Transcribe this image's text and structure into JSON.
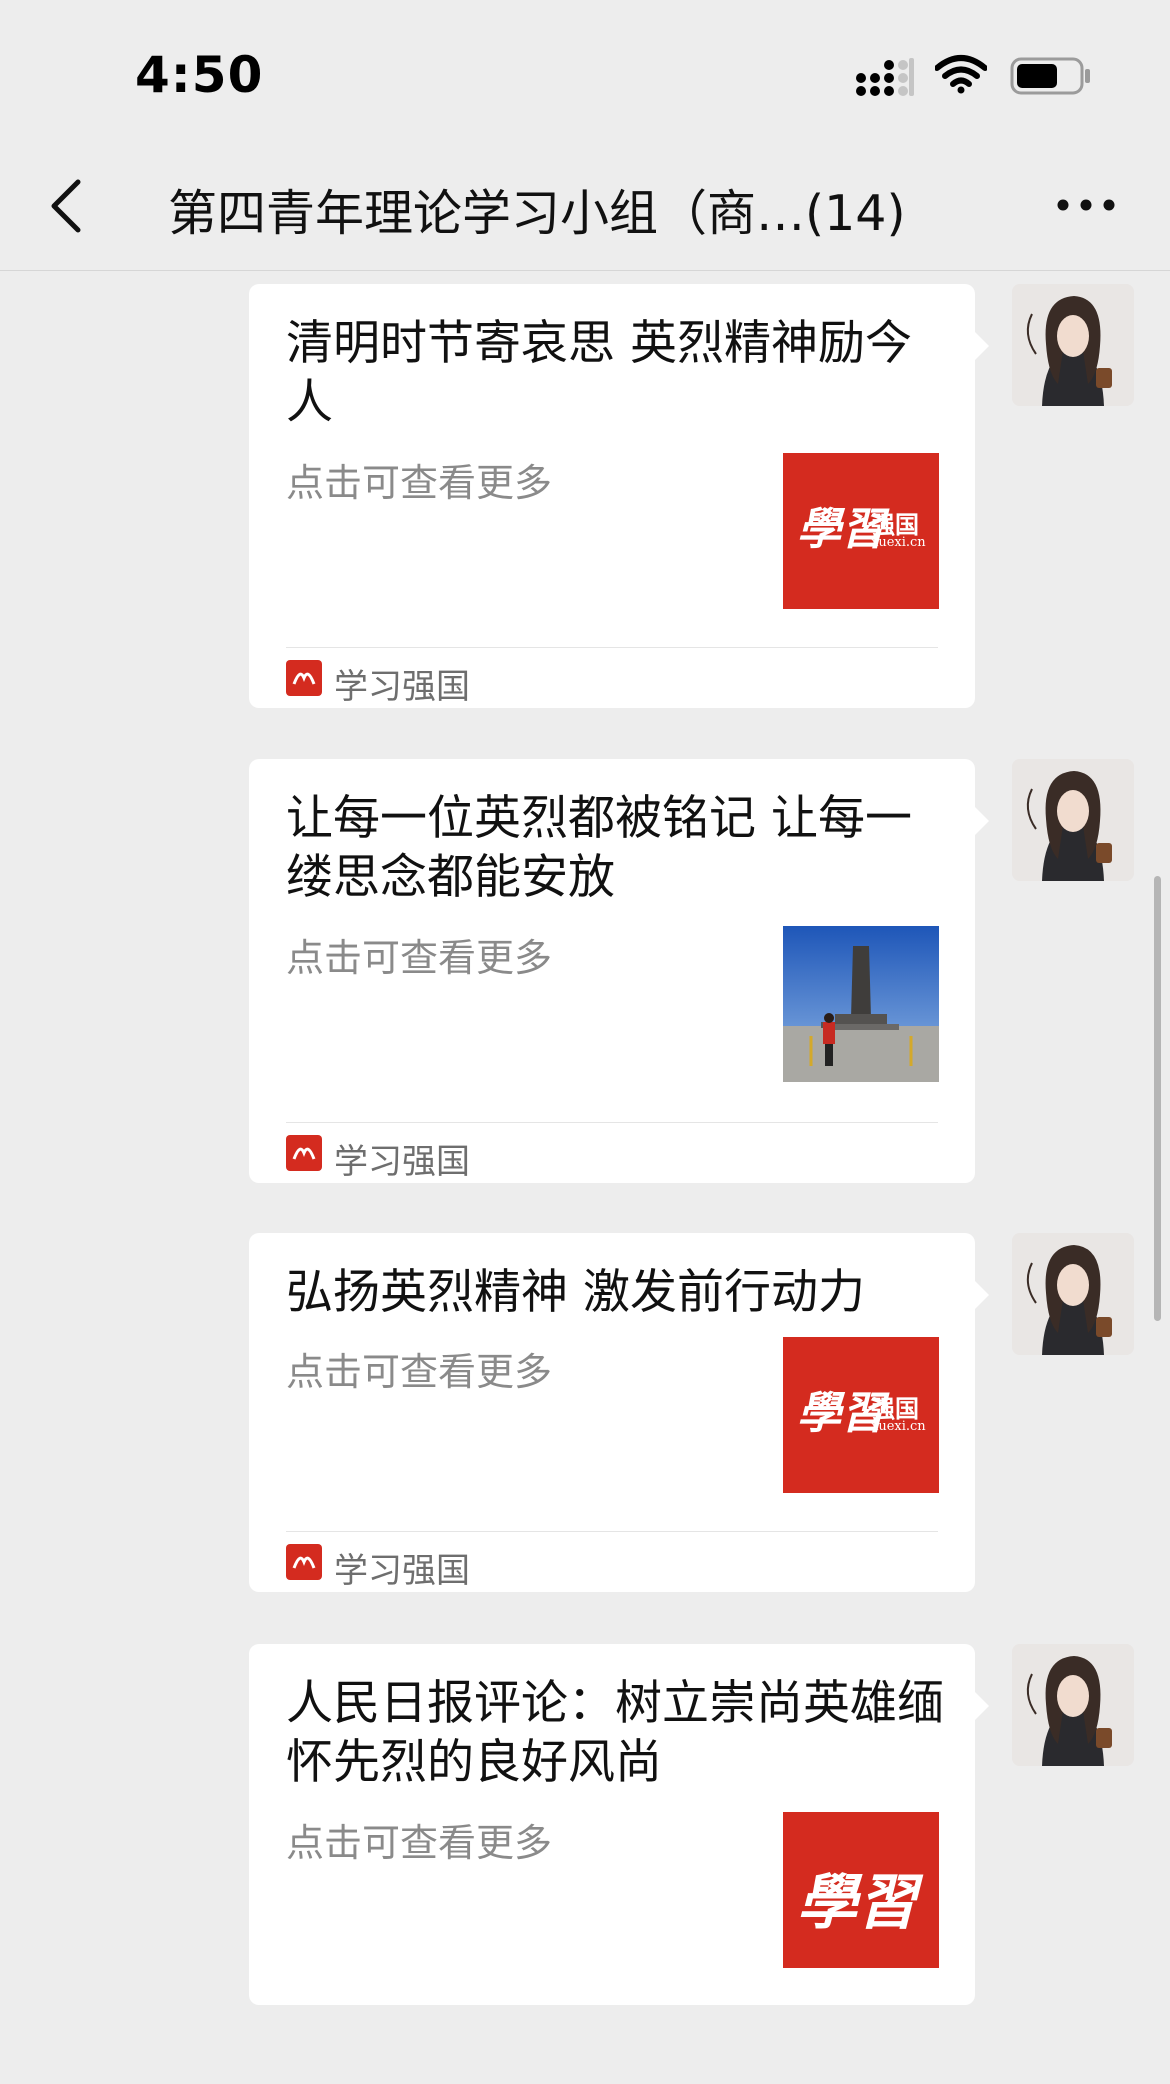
{
  "status_bar": {
    "time": "4:50"
  },
  "nav": {
    "title": "第四青年理论学习小组（商…(14)"
  },
  "messages": [
    {
      "title": "清明时节寄哀思 英烈精神励今人",
      "description": "点击可查看更多",
      "thumbnail": "xuexi-logo",
      "thumb_logo_main": "學習",
      "thumb_logo_side": "强国",
      "thumb_logo_url": "xuexi.cn",
      "source": "学习强国"
    },
    {
      "title": "让每一位英烈都被铭记 让每一缕思念都能安放",
      "description": "点击可查看更多",
      "thumbnail": "monument-photo",
      "source": "学习强国"
    },
    {
      "title": "弘扬英烈精神 激发前行动力",
      "description": "点击可查看更多",
      "thumbnail": "xuexi-logo",
      "thumb_logo_main": "學習",
      "thumb_logo_side": "强国",
      "thumb_logo_url": "xuexi.cn",
      "source": "学习强国"
    },
    {
      "title": "人民日报评论：树立崇尚英雄缅怀先烈的良好风尚",
      "description": "点击可查看更多",
      "thumbnail": "xuexi-logo-large",
      "thumb_logo_main": "學習"
    }
  ],
  "colors": {
    "background": "#ededed",
    "card": "#ffffff",
    "brand_red": "#d42b1f",
    "secondary_text": "#8a8a8a"
  }
}
